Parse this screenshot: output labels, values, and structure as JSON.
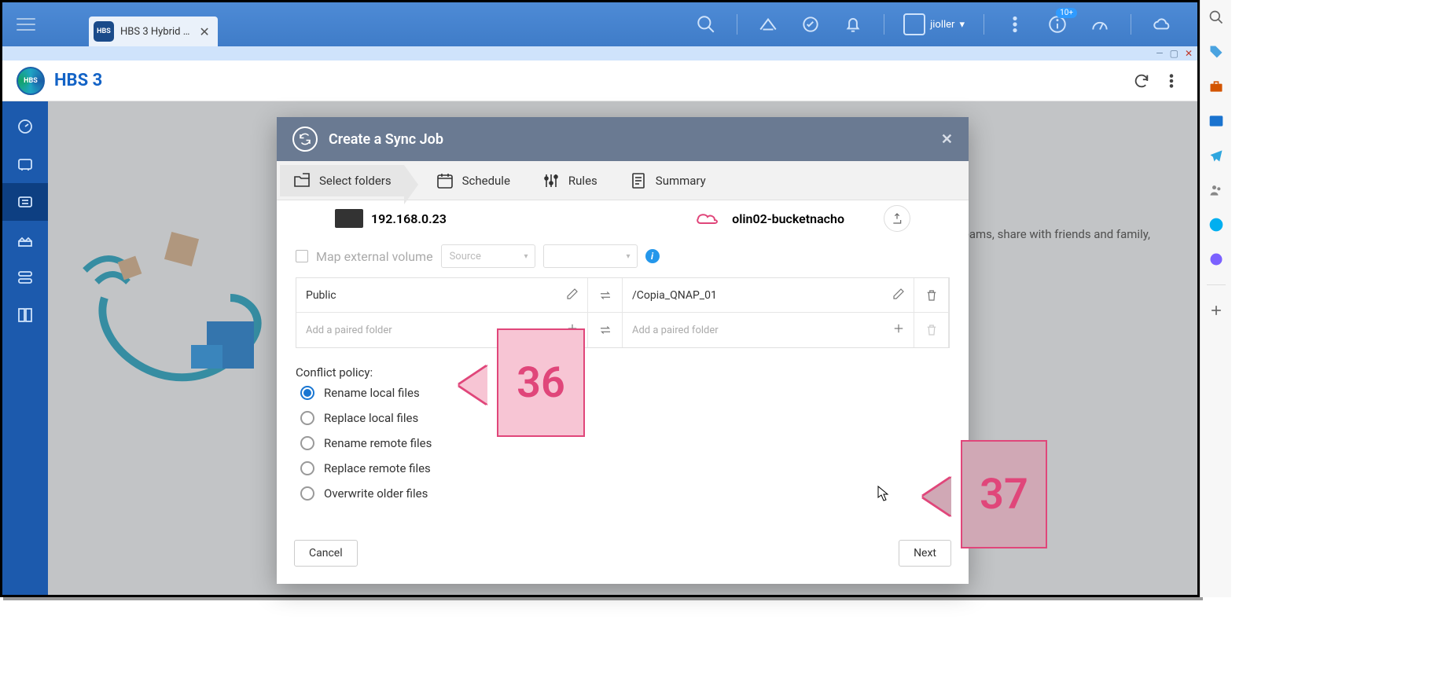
{
  "topbar": {
    "tab_title": "HBS 3 Hybrid …",
    "user": "jioller",
    "badge": "10+"
  },
  "hbs": {
    "title": "HBS 3"
  },
  "bg_hint": "with teams, share with friends and family,",
  "modal": {
    "title": "Create a Sync Job",
    "steps": {
      "select_folders": "Select folders",
      "schedule": "Schedule",
      "rules": "Rules",
      "summary": "Summary"
    },
    "local_host": "192.168.0.23",
    "remote_host": "olin02-bucketnacho",
    "map_external_label": "Map external volume",
    "source_placeholder": "Source",
    "pair": {
      "local": "Public",
      "remote": "/Copia_QNAP_01",
      "add_placeholder": "Add a paired folder"
    },
    "conflict_label": "Conflict policy:",
    "options": {
      "rename_local": "Rename local files",
      "replace_local": "Replace local files",
      "rename_remote": "Rename remote files",
      "replace_remote": "Replace remote files",
      "overwrite_older": "Overwrite older files"
    },
    "cancel": "Cancel",
    "next": "Next"
  },
  "annotations": {
    "a36": "36",
    "a37": "37"
  }
}
